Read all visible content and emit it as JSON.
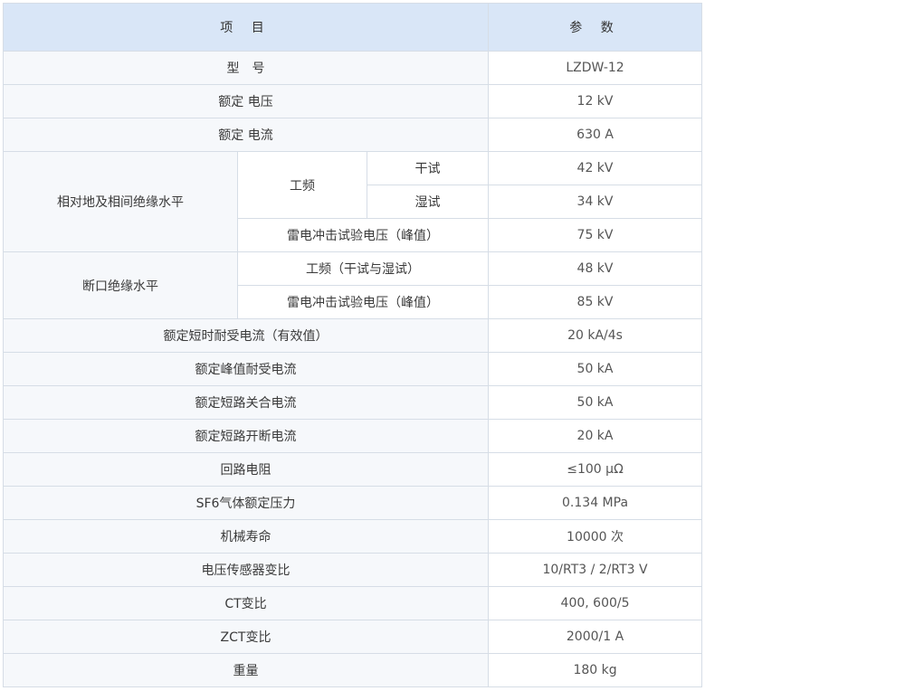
{
  "header": {
    "item": "项 目",
    "param": "参 数"
  },
  "rows": {
    "model": {
      "label": "型　号",
      "value": "LZDW-12"
    },
    "rated_voltage": {
      "label": "额定 电压",
      "value": "12 kV"
    },
    "rated_current": {
      "label": "额定 电流",
      "value": "630 A"
    },
    "phase_insulation": {
      "label": "相对地及相间绝缘水平",
      "power_freq": "工频",
      "dry": {
        "label": "干试",
        "value": "42 kV"
      },
      "wet": {
        "label": "湿试",
        "value": "34 kV"
      },
      "lightning": {
        "label": "雷电冲击试验电压（峰值）",
        "value": "75 kV"
      }
    },
    "break_insulation": {
      "label": "断口绝缘水平",
      "power_freq": {
        "label": "工频（干试与湿试）",
        "value": "48 kV"
      },
      "lightning": {
        "label": "雷电冲击试验电压（峰值）",
        "value": "85 kV"
      }
    },
    "short_time_current": {
      "label": "额定短时耐受电流（有效值）",
      "value": "20 kA/4s"
    },
    "peak_current": {
      "label": "额定峰值耐受电流",
      "value": "50 kA"
    },
    "making_current": {
      "label": "额定短路关合电流",
      "value": "50 kA"
    },
    "breaking_current": {
      "label": "额定短路开断电流",
      "value": "20 kA"
    },
    "loop_resistance": {
      "label": "回路电阻",
      "value": "≤100 μΩ"
    },
    "sf6_pressure": {
      "label": "SF6气体额定压力",
      "value": "0.134 MPa"
    },
    "mechanical_life": {
      "label": "机械寿命",
      "value": "10000 次"
    },
    "vt_ratio": {
      "label": "电压传感器变比",
      "value": "10/RT3 / 2/RT3 V"
    },
    "ct_ratio": {
      "label": "CT变比",
      "value": "400, 600/5"
    },
    "zct_ratio": {
      "label": "ZCT变比",
      "value": "2000/1 A"
    },
    "weight": {
      "label": "重量",
      "value": "180 kg"
    }
  }
}
